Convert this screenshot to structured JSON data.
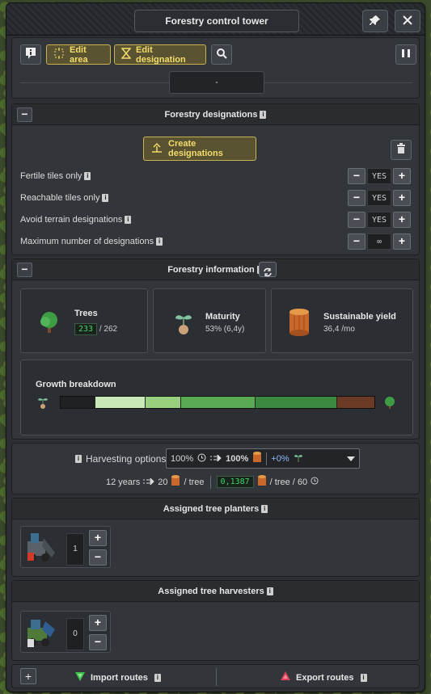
{
  "window": {
    "title": "Forestry control tower"
  },
  "toolbar": {
    "edit_area": "Edit area",
    "edit_designation": "Edit designation",
    "selected_value": "-"
  },
  "designations": {
    "title": "Forestry designations",
    "create_label": "Create designations",
    "options": [
      {
        "label": "Fertile tiles only",
        "value": "YES"
      },
      {
        "label": "Reachable tiles only",
        "value": "YES"
      },
      {
        "label": "Avoid terrain designations",
        "value": "YES"
      },
      {
        "label": "Maximum number of designations",
        "value": "∞"
      }
    ]
  },
  "information": {
    "title": "Forestry information",
    "trees": {
      "title": "Trees",
      "count": "233",
      "max": "/ 262"
    },
    "maturity": {
      "title": "Maturity",
      "value": "53% (6,4y)"
    },
    "yield": {
      "title": "Sustainable yield",
      "value": "36,4 /mo"
    },
    "growth": {
      "title": "Growth breakdown",
      "segments": [
        {
          "share": 0.11,
          "color": "#1f2123"
        },
        {
          "share": 0.16,
          "color": "#c9e8b7"
        },
        {
          "share": 0.11,
          "color": "#98d07f"
        },
        {
          "share": 0.24,
          "color": "#5aa955"
        },
        {
          "share": 0.26,
          "color": "#3b8a40"
        },
        {
          "share": 0.12,
          "color": "#6b3a25"
        }
      ]
    }
  },
  "harvesting": {
    "label": "Harvesting options:",
    "left_pct": "100%",
    "right_pct": "100%",
    "bonus": "+0%",
    "years": "12 years",
    "amount": "20",
    "per_tree": "/ tree",
    "digital": "0,1387",
    "per_tree_60": "/ tree / 60"
  },
  "planters": {
    "title": "Assigned tree planters",
    "count": "1"
  },
  "harvesters": {
    "title": "Assigned tree harvesters",
    "count": "0"
  },
  "routes": {
    "import": "Import routes",
    "export": "Export routes"
  },
  "colors": {
    "accent": "#f2dd6a",
    "digital": "#48d16a",
    "import": "#3ec24c",
    "export": "#d9425a"
  }
}
